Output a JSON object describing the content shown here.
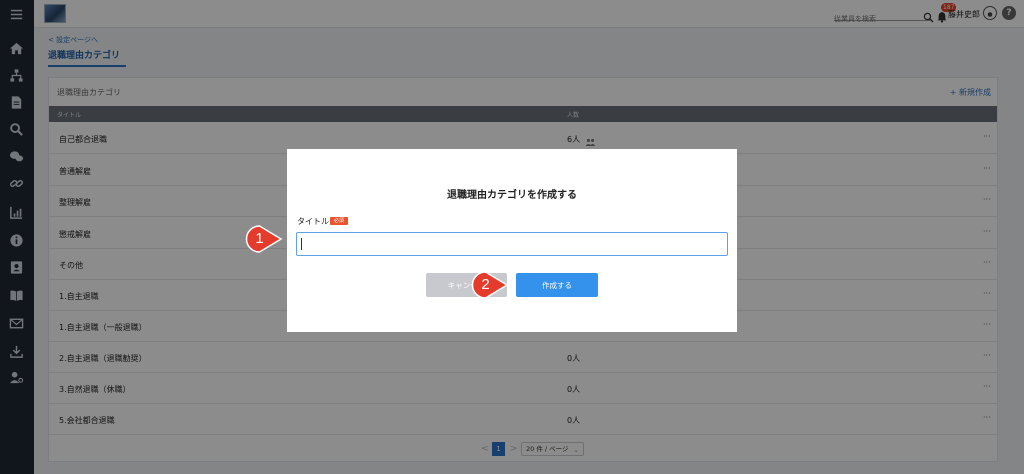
{
  "header": {
    "search_placeholder": "従業員を検索",
    "notification_count": "187",
    "user_name": "藤井史郎",
    "help_symbol": "?"
  },
  "breadcrumb": "< 設定ページへ",
  "page_title": "退職理由カテゴリ",
  "card": {
    "title": "退職理由カテゴリ",
    "new_label": "+ 新規作成",
    "columns": [
      "タイトル",
      "人数"
    ],
    "rows": [
      {
        "title": "自己都合退職",
        "count": "6人"
      },
      {
        "title": "普通解雇",
        "count": ""
      },
      {
        "title": "整理解雇",
        "count": ""
      },
      {
        "title": "懲戒解雇",
        "count": ""
      },
      {
        "title": "その他",
        "count": ""
      },
      {
        "title": "1.自主退職",
        "count": ""
      },
      {
        "title": "1.自主退職（一般退職）",
        "count": ""
      },
      {
        "title": "2.自主退職（退職勧奨）",
        "count": "0人"
      },
      {
        "title": "3.自然退職（休職）",
        "count": "0人"
      },
      {
        "title": "5.会社都合退職",
        "count": "0人"
      }
    ],
    "more_symbol": "···"
  },
  "pagination": {
    "prev": "<",
    "current": "1",
    "next": ">",
    "page_size": "20 件 / ページ"
  },
  "modal": {
    "title": "退職理由カテゴリを作成する",
    "field_label": "タイトル",
    "required_badge": "必須",
    "input_value": "",
    "cancel_label": "キャンセル",
    "create_label": "作成する"
  },
  "annotations": [
    {
      "number": "1"
    },
    {
      "number": "2"
    }
  ],
  "colors": {
    "sidebar": "#1f2733",
    "accent": "#2f73c9",
    "create_button": "#3592ec",
    "required_badge": "#e8542d",
    "marker": "#e53b2c"
  }
}
